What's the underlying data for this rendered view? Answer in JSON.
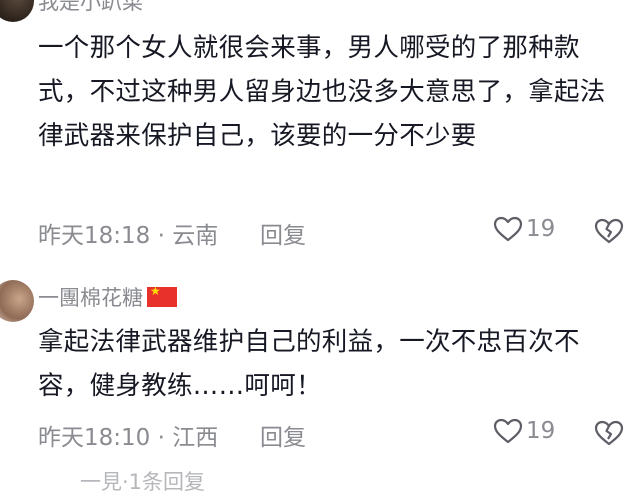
{
  "comments": [
    {
      "username": "我是小趴菜",
      "text": "一个那个女人就很会来事，男人哪受的了那种款式，不过这种男人留身边也没多大意思了，拿起法律武器来保护自己，该要的一分不少要",
      "time": "昨天18:18 · 云南",
      "reply_label": "回复",
      "likes": "19"
    },
    {
      "username": "一團棉花糖",
      "text": "拿起法律武器维护自己的利益，一次不忠百次不容，健身教练……呵呵！",
      "time": "昨天18:10 · 江西",
      "reply_label": "回复",
      "likes": "19"
    }
  ],
  "next_comment": {
    "username": "一見·1条回复"
  }
}
